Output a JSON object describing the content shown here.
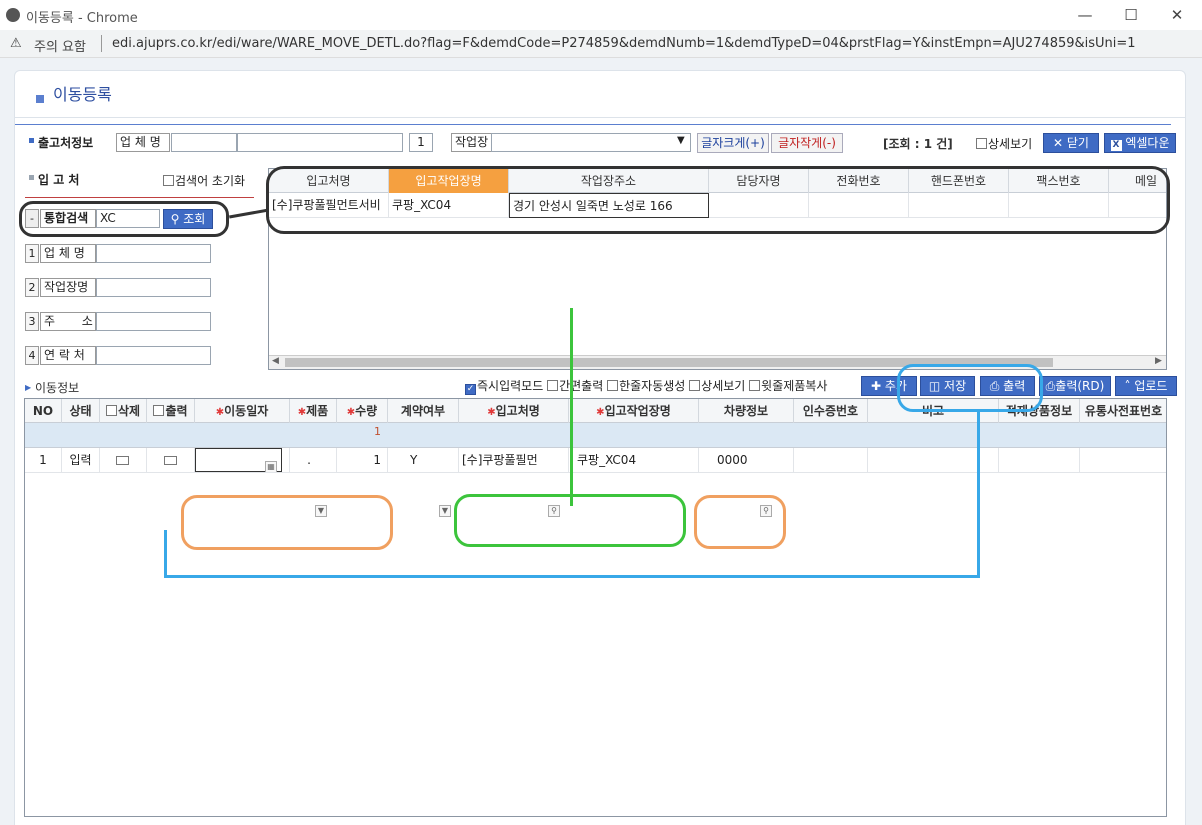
{
  "window": {
    "title": "이동등록 - Chrome",
    "security": "주의 요함",
    "url": "edi.ajuprs.co.kr/edi/ware/WARE_MOVE_DETL.do?flag=F&demdCode=P274859&demdNumb=1&demdTypeD=04&prstFlag=Y&instEmpn=AJU274859&isUni=1"
  },
  "page": {
    "title": "이동등록"
  },
  "top_bar": {
    "label": "출고처정보",
    "company_label": "업 체 명",
    "company_code": "",
    "company_name": "",
    "seq": "1",
    "workplace_label": "작업장",
    "workplace_value": "",
    "font_bigger": "글자크게(+)",
    "font_smaller": "글자작게(-)",
    "count_text": "[조회 : 1 건]",
    "detail_view": "상세보기",
    "close": "닫기",
    "excel": "엑셀다운"
  },
  "receiver": {
    "label": "입 고 처",
    "reset_checkbox": "검색어 초기화",
    "search_label": "통합검색",
    "search_value": "XC",
    "search_button": "조회",
    "fields": [
      {
        "num": "1",
        "label": "업 체 명",
        "value": ""
      },
      {
        "num": "2",
        "label": "작업장명",
        "value": ""
      },
      {
        "num": "3",
        "label": "주       소",
        "value": ""
      },
      {
        "num": "4",
        "label": "연 락 처",
        "value": ""
      }
    ]
  },
  "receiver_grid": {
    "headers": [
      "입고처명",
      "입고작업장명",
      "작업장주소",
      "담당자명",
      "전화번호",
      "핸드폰번호",
      "팩스번호",
      "메일"
    ],
    "rows": [
      [
        "[수]쿠팡풀필먼트서비",
        "쿠팡_XC04",
        "경기 안성시 일죽면 노성로 166",
        "",
        "",
        "",
        "",
        ""
      ]
    ]
  },
  "move_info": {
    "label": "이동정보",
    "options": [
      "즉시입력모드",
      "간편출력",
      "한줄자동생성",
      "상세보기",
      "윗줄제품복사"
    ],
    "buttons": {
      "add": "추가",
      "save": "저장",
      "print": "출력",
      "print_rd": "출력(RD)",
      "upload": "업로드"
    }
  },
  "move_grid": {
    "headers": [
      "NO",
      "상태",
      "삭제",
      "출력",
      "이동일자",
      "제품",
      "수량",
      "계약여부",
      "입고처명",
      "입고작업장명",
      "차량정보",
      "인수증번호",
      "비고",
      "적재상품정보",
      "유통사전표번호"
    ],
    "summary_qty": "1",
    "rows": [
      {
        "no": "1",
        "status": "입력",
        "date": "",
        "product": ".",
        "qty": "1",
        "contract": "Y",
        "receiver": "[수]쿠팡풀필먼",
        "workplace": "쿠팡_XC04",
        "vehicle": "0000",
        "receipt": "",
        "note": "",
        "load": "",
        "slip": ""
      }
    ]
  },
  "colors": {
    "accent": "#3f6bc4",
    "header_highlight": "#f5a040",
    "ann_black": "#333333",
    "ann_green": "#3cc43c",
    "ann_orange": "#f0a060",
    "ann_blue": "#38a8e8"
  }
}
